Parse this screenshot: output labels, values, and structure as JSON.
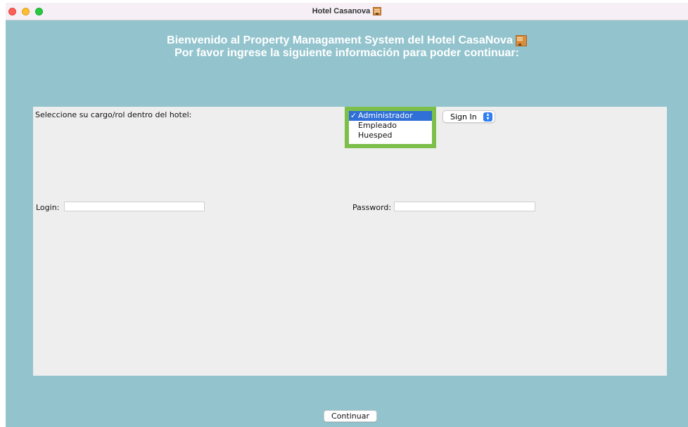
{
  "window": {
    "title": "Hotel Casanova"
  },
  "header": {
    "line1": "Bienvenido al Property Managament System del Hotel CasaNova",
    "line2": "Por favor ingrese la siguiente información para poder continuar:"
  },
  "form": {
    "role_label": "Seleccione su cargo/rol dentro del hotel:",
    "roles": [
      {
        "label": "Administrador",
        "selected": true
      },
      {
        "label": "Empleado",
        "selected": false
      },
      {
        "label": "Huesped",
        "selected": false
      }
    ],
    "mode_select_value": "Sign In",
    "login_label": "Login:",
    "login_value": "",
    "password_label": "Password:",
    "password_value": ""
  },
  "footer": {
    "continue_label": "Continuar"
  },
  "colors": {
    "background": "#93c4ce",
    "panel": "#eeeeee",
    "selection": "#2f6fd6",
    "list_highlight_border": "#7cc04b"
  }
}
